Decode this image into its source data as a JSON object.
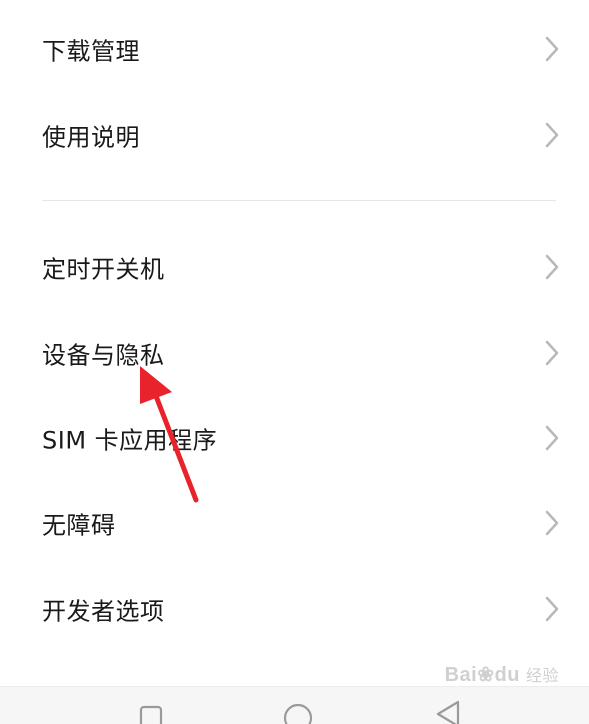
{
  "menu": {
    "items": [
      {
        "label": "下载管理"
      },
      {
        "label": "使用说明"
      },
      {
        "label": "定时开关机"
      },
      {
        "label": "设备与隐私"
      },
      {
        "label": "SIM 卡应用程序"
      },
      {
        "label": "无障碍"
      },
      {
        "label": "开发者选项"
      }
    ]
  },
  "icons": {
    "chevron": "chevron-right-icon",
    "nav_recent": "square-icon",
    "nav_home": "circle-icon",
    "nav_back": "triangle-back-icon"
  },
  "watermark": {
    "brand": "Bai",
    "brand2": "du",
    "sub": "经验"
  },
  "colors": {
    "text": "#1a1a1a",
    "chevron": "#b8b8b8",
    "divider": "#e6e6e6",
    "annotation_arrow": "#e8232b"
  }
}
